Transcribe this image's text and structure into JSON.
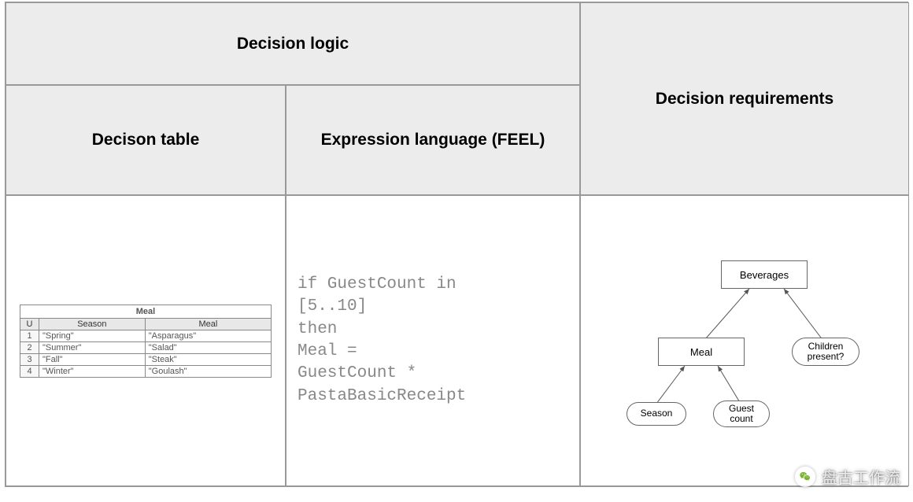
{
  "headers": {
    "top": "Decision logic",
    "right": "Decision requirements",
    "sub1": "Decison table",
    "sub2": "Expression language (FEEL)"
  },
  "decision_table": {
    "title": "Meal",
    "hit_policy": "U",
    "columns": [
      "Season",
      "Meal"
    ],
    "rows": [
      {
        "n": "1",
        "season": "\"Spring\"",
        "meal": "\"Asparagus\""
      },
      {
        "n": "2",
        "season": "\"Summer\"",
        "meal": "\"Salad\""
      },
      {
        "n": "3",
        "season": "\"Fall\"",
        "meal": "\"Steak\""
      },
      {
        "n": "4",
        "season": "\"Winter\"",
        "meal": "\"Goulash\""
      }
    ]
  },
  "feel_code": "if GuestCount in\n[5..10]\nthen\nMeal =\nGuestCount *\nPastaBasicReceipt",
  "dmn": {
    "nodes": {
      "beverages": "Beverages",
      "meal": "Meal",
      "children": "Children present?",
      "season": "Season",
      "guestcount": "Guest count"
    }
  },
  "watermark": "盘古工作流"
}
